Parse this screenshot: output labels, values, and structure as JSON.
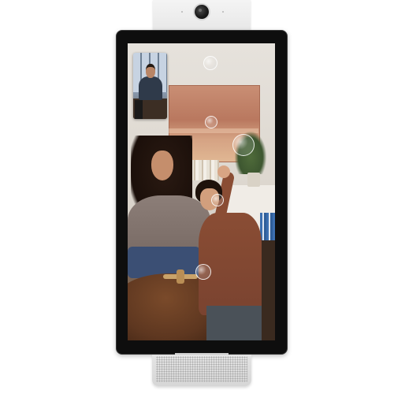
{
  "device": {
    "camera": {
      "icon": "camera-lens-icon"
    },
    "speaker": {
      "icon": "speaker-grille-icon"
    }
  },
  "screen": {
    "main_view": {
      "description_icon": "video-call-main-feed"
    },
    "pip_view": {
      "icon": "self-view-thumbnail"
    }
  },
  "colors": {
    "bezel": "#0e0e0e",
    "housing": "#e6e6e6",
    "speaker": "#d6d6d6"
  }
}
